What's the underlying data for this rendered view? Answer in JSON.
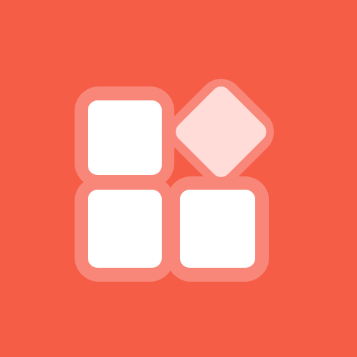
{
  "icon": {
    "name": "apps-grid-icon",
    "description_visible_text": "",
    "colors": {
      "background": "#f55d47",
      "tile_outline": "#f8877a",
      "tile_fill": "#ffffff",
      "diamond_fill": "#ffdcd8"
    }
  }
}
